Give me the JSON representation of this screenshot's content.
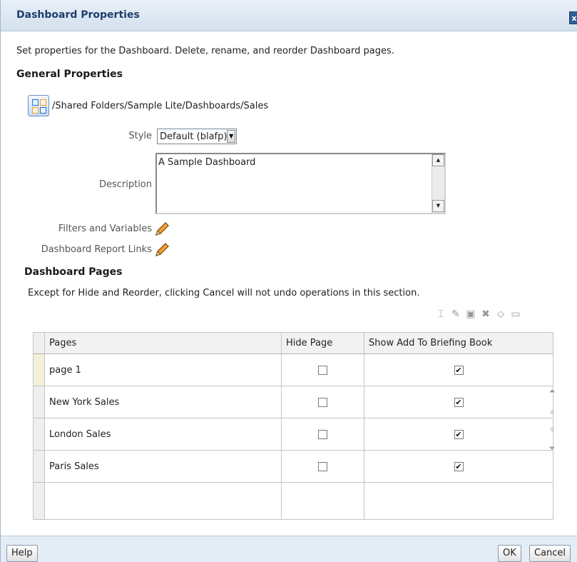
{
  "dialog": {
    "title": "Dashboard Properties",
    "close_symbol": "x"
  },
  "intro_text": "Set properties for the Dashboard. Delete, rename, and reorder Dashboard pages.",
  "general": {
    "heading": "General Properties",
    "path": "/Shared Folders/Sample Lite/Dashboards/Sales",
    "path_icon": "dashboard-icon",
    "style_label": "Style",
    "style_value": "Default (blafp)",
    "description_label": "Description",
    "description_value": "A Sample Dashboard",
    "filters_label": "Filters and Variables",
    "report_links_label": "Dashboard Report Links"
  },
  "pages_section": {
    "heading": "Dashboard Pages",
    "note": "Except for Hide and Reorder, clicking Cancel will not undo operations in this section.",
    "toolbar_icons": [
      "rename-icon",
      "page-permissions-icon",
      "page-lock-icon",
      "delete-icon",
      "view-icon",
      "report-icon"
    ],
    "columns": [
      "Pages",
      "Hide Page",
      "Show Add To Briefing Book"
    ],
    "rows": [
      {
        "name": "page 1",
        "hide": false,
        "briefing": true
      },
      {
        "name": "New York Sales",
        "hide": false,
        "briefing": true
      },
      {
        "name": "London Sales",
        "hide": false,
        "briefing": true
      },
      {
        "name": "Paris Sales",
        "hide": false,
        "briefing": true
      }
    ],
    "reorder_icons": [
      "move-to-top-icon",
      "move-up-icon",
      "move-down-icon",
      "move-to-bottom-icon"
    ]
  },
  "footer": {
    "help_label": "Help",
    "ok_label": "OK",
    "cancel_label": "Cancel"
  },
  "colors": {
    "title_text": "#1d3f6b",
    "accent_blue": "#2f5f9a",
    "pencil_orange": "#f0a030"
  }
}
